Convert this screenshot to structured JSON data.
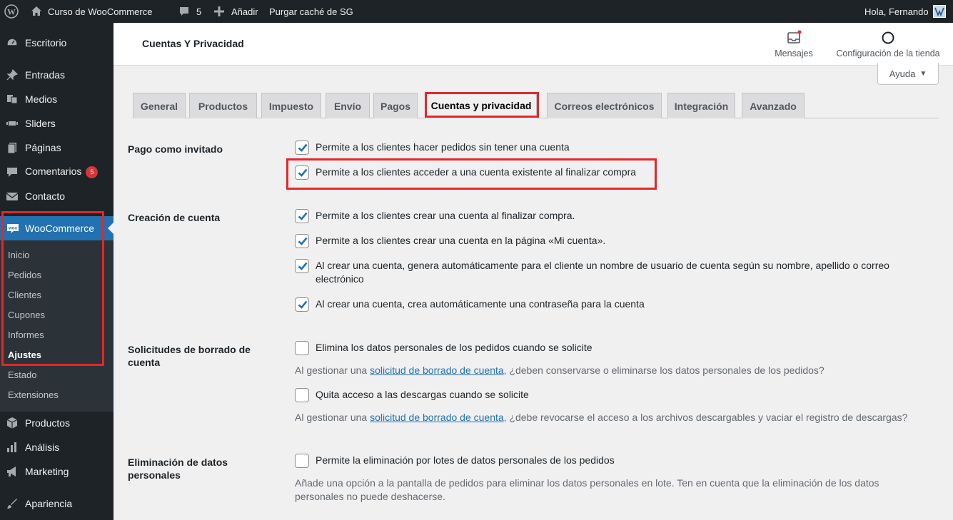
{
  "admin_bar": {
    "site_name": "Curso de WooCommerce",
    "comments_count": "5",
    "new_label": "Añadir",
    "purge_label": "Purgar caché de SG",
    "greeting": "Hola, Fernando"
  },
  "sidebar": {
    "items": [
      {
        "label": "Escritorio",
        "icon": "dashboard-icon"
      },
      {
        "label": "Entradas",
        "icon": "pin-icon"
      },
      {
        "label": "Medios",
        "icon": "media-icon"
      },
      {
        "label": "Sliders",
        "icon": "slider-icon"
      },
      {
        "label": "Páginas",
        "icon": "page-icon"
      },
      {
        "label": "Comentarios",
        "icon": "comment-icon",
        "badge": "5"
      },
      {
        "label": "Contacto",
        "icon": "mail-icon"
      },
      {
        "label": "WooCommerce",
        "icon": "woo-icon"
      },
      {
        "label": "Productos",
        "icon": "box-icon"
      },
      {
        "label": "Análisis",
        "icon": "chart-bar-icon"
      },
      {
        "label": "Marketing",
        "icon": "megaphone-icon"
      },
      {
        "label": "Apariencia",
        "icon": "brush-icon"
      }
    ],
    "submenu": [
      "Inicio",
      "Pedidos",
      "Clientes",
      "Cupones",
      "Informes",
      "Ajustes",
      "Estado",
      "Extensiones"
    ]
  },
  "header": {
    "title": "Cuentas Y Privacidad",
    "messages_label": "Mensajes",
    "store_setup_label": "Configuración de la tienda",
    "help_label": "Ayuda"
  },
  "tabs": [
    "General",
    "Productos",
    "Impuesto",
    "Envío",
    "Pagos",
    "Cuentas y privacidad",
    "Correos electrónicos",
    "Integración",
    "Avanzado"
  ],
  "active_tab": "Cuentas y privacidad",
  "form": {
    "guest_checkout": {
      "label": "Pago como invitado",
      "options": [
        {
          "text": "Permite a los clientes hacer pedidos sin tener una cuenta",
          "checked": true
        },
        {
          "text": "Permite a los clientes acceder a una cuenta existente al finalizar compra",
          "checked": true
        }
      ]
    },
    "account_creation": {
      "label": "Creación de cuenta",
      "options": [
        {
          "text": "Permite a los clientes crear una cuenta al finalizar compra.",
          "checked": true
        },
        {
          "text": "Permite a los clientes crear una cuenta en la página «Mi cuenta».",
          "checked": true
        },
        {
          "text": "Al crear una cuenta, genera automáticamente para el cliente un nombre de usuario de cuenta según su nombre, apellido o correo electrónico",
          "checked": true
        },
        {
          "text": "Al crear una cuenta, crea automáticamente una contraseña para la cuenta",
          "checked": true
        }
      ]
    },
    "erasure": {
      "label": "Solicitudes de borrado de cuenta",
      "option1": "Elimina los datos personales de los pedidos cuando se solicite",
      "desc1_before": "Al gestionar una ",
      "desc1_link": "solicitud de borrado de cuenta",
      "desc1_after": ", ¿deben conservarse o eliminarse los datos personales de los pedidos?",
      "option2": "Quita acceso a las descargas cuando se solicite",
      "desc2_before": "Al gestionar una ",
      "desc2_link": "solicitud de borrado de cuenta",
      "desc2_after": ", ¿debe revocarse el acceso a los archivos descargables y vaciar el registro de descargas?"
    },
    "personal_data_removal": {
      "label": "Eliminación de datos personales",
      "option": "Permite la eliminación por lotes de datos personales de los pedidos",
      "desc": "Añade una opción a la pantalla de pedidos para eliminar los datos personales en lote. Ten en cuenta que la eliminación de los datos personales no puede deshacerse."
    }
  },
  "colors": {
    "admin_dark": "#1d2327",
    "submenu_bg": "#2c3338",
    "wp_blue": "#2271b1",
    "highlight_red": "#e5262a",
    "badge_red": "#d63638"
  }
}
